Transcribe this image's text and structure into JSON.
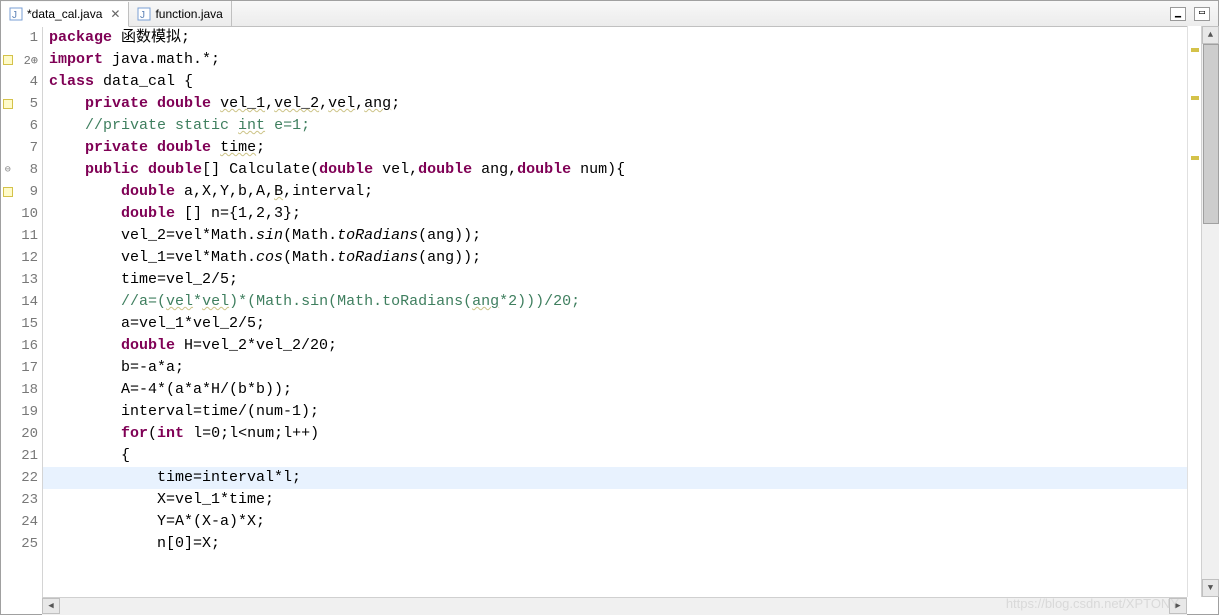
{
  "tabs": [
    {
      "label": "*data_cal.java",
      "active": true
    },
    {
      "label": "function.java",
      "active": false
    }
  ],
  "lines": [
    {
      "num": "1",
      "marker": "",
      "highlight": false,
      "tokens": [
        {
          "cls": "kw",
          "t": "package"
        },
        {
          "cls": "normal",
          "t": " 函数模拟;"
        }
      ]
    },
    {
      "num": "2",
      "marker": "warn-expand",
      "highlight": false,
      "tokens": [
        {
          "cls": "kw",
          "t": "import"
        },
        {
          "cls": "normal",
          "t": " java.math.*;"
        }
      ]
    },
    {
      "num": "4",
      "marker": "",
      "highlight": false,
      "tokens": [
        {
          "cls": "kw",
          "t": "class"
        },
        {
          "cls": "normal",
          "t": " data_cal {"
        }
      ]
    },
    {
      "num": "5",
      "marker": "warn",
      "highlight": false,
      "tokens": [
        {
          "cls": "normal",
          "t": "    "
        },
        {
          "cls": "kw",
          "t": "private"
        },
        {
          "cls": "normal",
          "t": " "
        },
        {
          "cls": "kw",
          "t": "double"
        },
        {
          "cls": "normal",
          "t": " "
        },
        {
          "cls": "wavy",
          "t": "vel_1"
        },
        {
          "cls": "normal",
          "t": ","
        },
        {
          "cls": "wavy",
          "t": "vel_2"
        },
        {
          "cls": "normal",
          "t": ","
        },
        {
          "cls": "wavy",
          "t": "vel"
        },
        {
          "cls": "normal",
          "t": ","
        },
        {
          "cls": "wavy",
          "t": "ang"
        },
        {
          "cls": "normal",
          "t": ";"
        }
      ]
    },
    {
      "num": "6",
      "marker": "",
      "highlight": false,
      "tokens": [
        {
          "cls": "normal",
          "t": "    "
        },
        {
          "cls": "comment",
          "t": "//private static "
        },
        {
          "cls": "comment wavy",
          "t": "int"
        },
        {
          "cls": "comment",
          "t": " e=1;"
        }
      ]
    },
    {
      "num": "7",
      "marker": "",
      "highlight": false,
      "tokens": [
        {
          "cls": "normal",
          "t": "    "
        },
        {
          "cls": "kw",
          "t": "private"
        },
        {
          "cls": "normal",
          "t": " "
        },
        {
          "cls": "kw",
          "t": "double"
        },
        {
          "cls": "normal",
          "t": " "
        },
        {
          "cls": "wavy",
          "t": "time"
        },
        {
          "cls": "normal",
          "t": ";"
        }
      ]
    },
    {
      "num": "8",
      "marker": "fold",
      "highlight": false,
      "tokens": [
        {
          "cls": "normal",
          "t": "    "
        },
        {
          "cls": "kw",
          "t": "public"
        },
        {
          "cls": "normal",
          "t": " "
        },
        {
          "cls": "kw",
          "t": "double"
        },
        {
          "cls": "normal",
          "t": "[] Calculate("
        },
        {
          "cls": "kw",
          "t": "double"
        },
        {
          "cls": "normal",
          "t": " vel,"
        },
        {
          "cls": "kw",
          "t": "double"
        },
        {
          "cls": "normal",
          "t": " ang,"
        },
        {
          "cls": "kw",
          "t": "double"
        },
        {
          "cls": "normal",
          "t": " num){"
        }
      ]
    },
    {
      "num": "9",
      "marker": "warn",
      "highlight": false,
      "tokens": [
        {
          "cls": "normal",
          "t": "        "
        },
        {
          "cls": "kw",
          "t": "double"
        },
        {
          "cls": "normal",
          "t": " a,X,Y,b,A,"
        },
        {
          "cls": "wavy",
          "t": "B"
        },
        {
          "cls": "normal",
          "t": ",interval;"
        }
      ]
    },
    {
      "num": "10",
      "marker": "",
      "highlight": false,
      "tokens": [
        {
          "cls": "normal",
          "t": "        "
        },
        {
          "cls": "kw",
          "t": "double"
        },
        {
          "cls": "normal",
          "t": " [] n={1,2,3};"
        }
      ]
    },
    {
      "num": "11",
      "marker": "",
      "highlight": false,
      "tokens": [
        {
          "cls": "normal",
          "t": "        vel_2=vel*Math."
        },
        {
          "cls": "italic",
          "t": "sin"
        },
        {
          "cls": "normal",
          "t": "(Math."
        },
        {
          "cls": "italic",
          "t": "toRadians"
        },
        {
          "cls": "normal",
          "t": "(ang));"
        }
      ]
    },
    {
      "num": "12",
      "marker": "",
      "highlight": false,
      "tokens": [
        {
          "cls": "normal",
          "t": "        vel_1=vel*Math."
        },
        {
          "cls": "italic",
          "t": "cos"
        },
        {
          "cls": "normal",
          "t": "(Math."
        },
        {
          "cls": "italic",
          "t": "toRadians"
        },
        {
          "cls": "normal",
          "t": "(ang));"
        }
      ]
    },
    {
      "num": "13",
      "marker": "",
      "highlight": false,
      "tokens": [
        {
          "cls": "normal",
          "t": "        time=vel_2/5;"
        }
      ]
    },
    {
      "num": "14",
      "marker": "",
      "highlight": false,
      "tokens": [
        {
          "cls": "normal",
          "t": "        "
        },
        {
          "cls": "comment",
          "t": "//a=("
        },
        {
          "cls": "comment wavy",
          "t": "vel"
        },
        {
          "cls": "comment",
          "t": "*"
        },
        {
          "cls": "comment wavy",
          "t": "vel"
        },
        {
          "cls": "comment",
          "t": ")*(Math.sin(Math.toRadians("
        },
        {
          "cls": "comment wavy",
          "t": "ang"
        },
        {
          "cls": "comment",
          "t": "*2)))/20;"
        }
      ]
    },
    {
      "num": "15",
      "marker": "",
      "highlight": false,
      "tokens": [
        {
          "cls": "normal",
          "t": "        a=vel_1*vel_2/5;"
        }
      ]
    },
    {
      "num": "16",
      "marker": "",
      "highlight": false,
      "tokens": [
        {
          "cls": "normal",
          "t": "        "
        },
        {
          "cls": "kw",
          "t": "double"
        },
        {
          "cls": "normal",
          "t": " H=vel_2*vel_2/20;"
        }
      ]
    },
    {
      "num": "17",
      "marker": "",
      "highlight": false,
      "tokens": [
        {
          "cls": "normal",
          "t": "        b=-a*a;"
        }
      ]
    },
    {
      "num": "18",
      "marker": "",
      "highlight": false,
      "tokens": [
        {
          "cls": "normal",
          "t": "        A=-4*(a*a*H/(b*b));"
        }
      ]
    },
    {
      "num": "19",
      "marker": "",
      "highlight": false,
      "tokens": [
        {
          "cls": "normal",
          "t": "        interval=time/(num-1);"
        }
      ]
    },
    {
      "num": "20",
      "marker": "",
      "highlight": false,
      "tokens": [
        {
          "cls": "normal",
          "t": "        "
        },
        {
          "cls": "kw",
          "t": "for"
        },
        {
          "cls": "normal",
          "t": "("
        },
        {
          "cls": "kw",
          "t": "int"
        },
        {
          "cls": "normal",
          "t": " l=0;l<num;l++)"
        }
      ]
    },
    {
      "num": "21",
      "marker": "",
      "highlight": false,
      "tokens": [
        {
          "cls": "normal",
          "t": "        {"
        }
      ]
    },
    {
      "num": "22",
      "marker": "",
      "highlight": true,
      "tokens": [
        {
          "cls": "normal",
          "t": "            time=interval*l;"
        }
      ]
    },
    {
      "num": "23",
      "marker": "",
      "highlight": false,
      "tokens": [
        {
          "cls": "normal",
          "t": "            X=vel_1*time;"
        }
      ]
    },
    {
      "num": "24",
      "marker": "",
      "highlight": false,
      "tokens": [
        {
          "cls": "normal",
          "t": "            Y=A*(X-a)*X;"
        }
      ]
    },
    {
      "num": "25",
      "marker": "",
      "highlight": false,
      "tokens": [
        {
          "cls": "normal",
          "t": "            n[0]=X;"
        }
      ]
    }
  ],
  "watermark": "https://blog.csdn.net/XPTONY"
}
